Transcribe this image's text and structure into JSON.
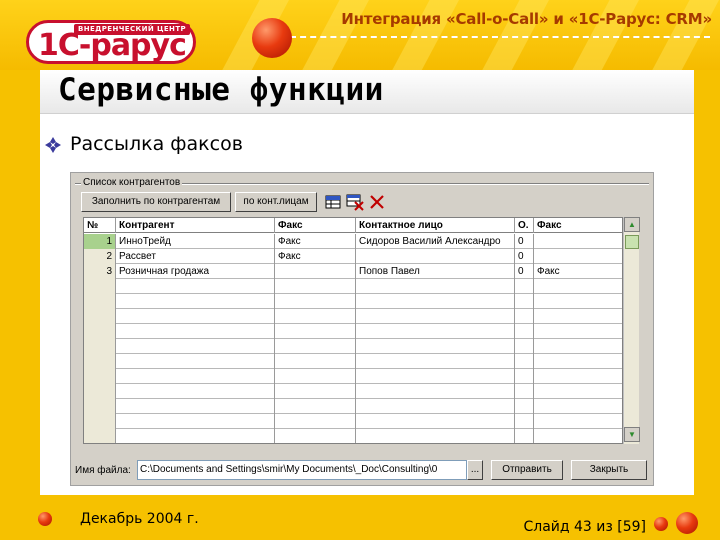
{
  "header": {
    "title": "Интеграция «Call-o-Call» и «1С-Рарус: CRM»",
    "logo_caption": "ВНЕДРЕНЧЕСКИЙ ЦЕНТР",
    "logo_text": "1С-рарус"
  },
  "slide": {
    "title": "Сервисные функции",
    "bullet": "Рассылка факсов"
  },
  "form": {
    "group_title": "Список контрагентов",
    "buttons": {
      "fill_by_contractors": "Заполнить по контрагентам",
      "by_contacts": "по конт.лицам",
      "send": "Отправить",
      "close": "Закрыть",
      "browse": "..."
    },
    "table": {
      "columns": [
        "№",
        "Контрагент",
        "Факс",
        "Контактное лицо",
        "О.",
        "Факс"
      ],
      "rows": [
        [
          "1",
          "ИнноТрейд",
          "Факс",
          "Сидоров Василий Александро",
          "0",
          ""
        ],
        [
          "2",
          "Рассвет",
          "Факс",
          "",
          "0",
          ""
        ],
        [
          "3",
          "Розничная гродажа",
          "",
          "Попов Павел",
          "0",
          "Факс"
        ]
      ],
      "selected_row": 0
    },
    "file": {
      "label": "Имя файла:",
      "value": "C:\\Documents and Settings\\smir\\My Documents\\_Doc\\Consulting\\0"
    }
  },
  "footer": {
    "date": "Декабрь 2004 г.",
    "page": "Слайд 43 из [59]"
  },
  "colors": {
    "background": "#f6c100",
    "brand_red": "#c8102e",
    "header_text": "#a63a00",
    "selected_row": "#a8d18d"
  }
}
